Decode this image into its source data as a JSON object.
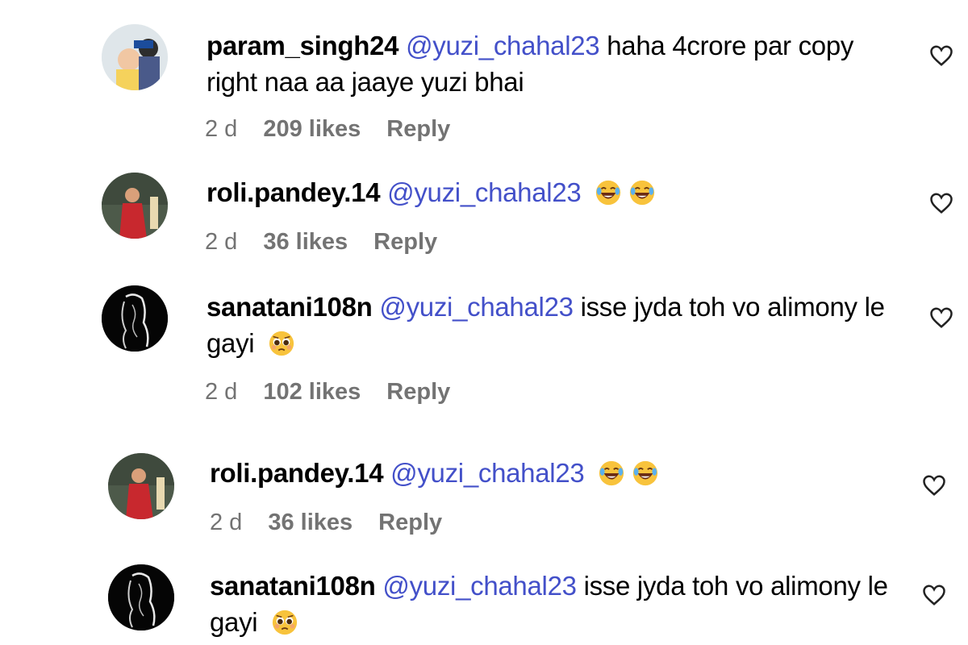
{
  "comments": [
    {
      "username": "param_singh24",
      "mention": "@yuzi_chahal23",
      "text": "haha 4crore par copy right naa aa jaaye yuzi bhai",
      "emojis": [],
      "age": "2 d",
      "likes": "209 likes",
      "reply": "Reply",
      "avatar_icon": "user-avatar-photo"
    },
    {
      "username": "roli.pandey.14",
      "mention": "@yuzi_chahal23",
      "text": "",
      "emojis": [
        "face-with-tears-of-joy",
        "face-with-tears-of-joy"
      ],
      "age": "2 d",
      "likes": "36 likes",
      "reply": "Reply",
      "avatar_icon": "user-avatar-photo"
    },
    {
      "username": "sanatani108n",
      "mention": "@yuzi_chahal23",
      "text": "isse jyda toh vo alimony le gayi",
      "emojis": [
        "pleading-face"
      ],
      "age": "2 d",
      "likes": "102 likes",
      "reply": "Reply",
      "avatar_icon": "user-avatar-dark-art"
    },
    {
      "username": "roli.pandey.14",
      "mention": "@yuzi_chahal23",
      "text": "",
      "emojis": [
        "face-with-tears-of-joy",
        "face-with-tears-of-joy"
      ],
      "age": "2 d",
      "likes": "36 likes",
      "reply": "Reply",
      "avatar_icon": "user-avatar-photo"
    },
    {
      "username": "sanatani108n",
      "mention": "@yuzi_chahal23",
      "text": "isse jyda toh vo alimony le gayi",
      "emojis": [
        "pleading-face"
      ],
      "age": "",
      "likes": "",
      "reply": "",
      "avatar_icon": "user-avatar-dark-art"
    }
  ],
  "colors": {
    "mention": "#4350c9",
    "meta": "#737373",
    "emoji_yellow": "#f8c33c"
  }
}
